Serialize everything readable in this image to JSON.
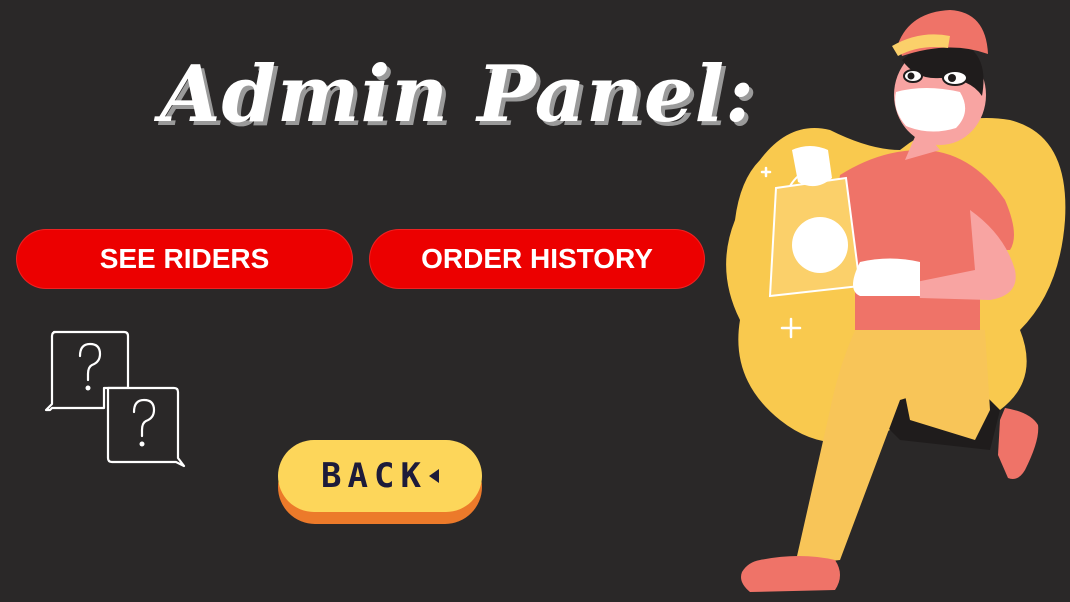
{
  "header": {
    "title": "Admin Panel:"
  },
  "actions": {
    "see_riders_label": "SEE RIDERS",
    "order_history_label": "ORDER HISTORY",
    "back_label": "BACK"
  },
  "icons": {
    "help": "question-chat-icon",
    "back_arrow": "triangle-left-icon",
    "illustration": "delivery-courier-illustration"
  },
  "colors": {
    "background": "#2a2828",
    "primary_button": "#ec0000",
    "back_button": "#fdd65a",
    "back_button_shadow": "#ec7a2a",
    "blob": "#f9c94e",
    "shirt": "#ef7368",
    "pants": "#f8c558"
  }
}
